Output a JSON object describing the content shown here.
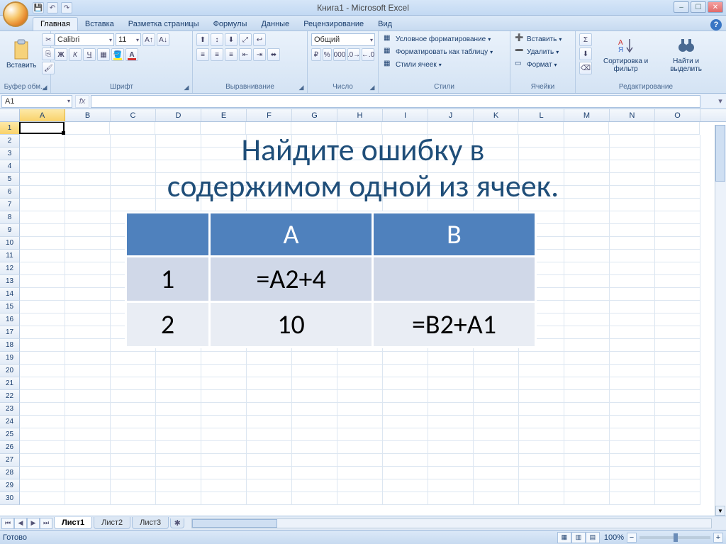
{
  "title": "Книга1 - Microsoft Excel",
  "tabs": {
    "home": "Главная",
    "insert": "Вставка",
    "layout": "Разметка страницы",
    "formulas": "Формулы",
    "data": "Данные",
    "review": "Рецензирование",
    "view": "Вид"
  },
  "ribbon": {
    "clipboard": {
      "label": "Буфер обм...",
      "paste": "Вставить"
    },
    "font": {
      "label": "Шрифт",
      "name": "Calibri",
      "size": "11"
    },
    "alignment": {
      "label": "Выравнивание"
    },
    "number": {
      "label": "Число",
      "format": "Общий"
    },
    "styles": {
      "label": "Стили",
      "cond": "Условное форматирование",
      "table": "Форматировать как таблицу",
      "cell": "Стили ячеек"
    },
    "cells": {
      "label": "Ячейки",
      "insert": "Вставить",
      "delete": "Удалить",
      "format": "Формат"
    },
    "editing": {
      "label": "Редактирование",
      "sort": "Сортировка и фильтр",
      "find": "Найти и выделить"
    }
  },
  "name_box": "A1",
  "columns": [
    "A",
    "B",
    "C",
    "D",
    "E",
    "F",
    "G",
    "H",
    "I",
    "J",
    "K",
    "L",
    "M",
    "N",
    "O"
  ],
  "overlay": {
    "title_line1": "Найдите ошибку в",
    "title_line2": "содержимом одной из ячеек.",
    "headers": {
      "a": "A",
      "b": "B"
    },
    "rows": [
      {
        "num": "1",
        "a": "=А2+4",
        "b": ""
      },
      {
        "num": "2",
        "a": "10",
        "b": "=В2+А1"
      }
    ]
  },
  "sheets": {
    "s1": "Лист1",
    "s2": "Лист2",
    "s3": "Лист3"
  },
  "status": {
    "ready": "Готово",
    "zoom": "100%"
  }
}
